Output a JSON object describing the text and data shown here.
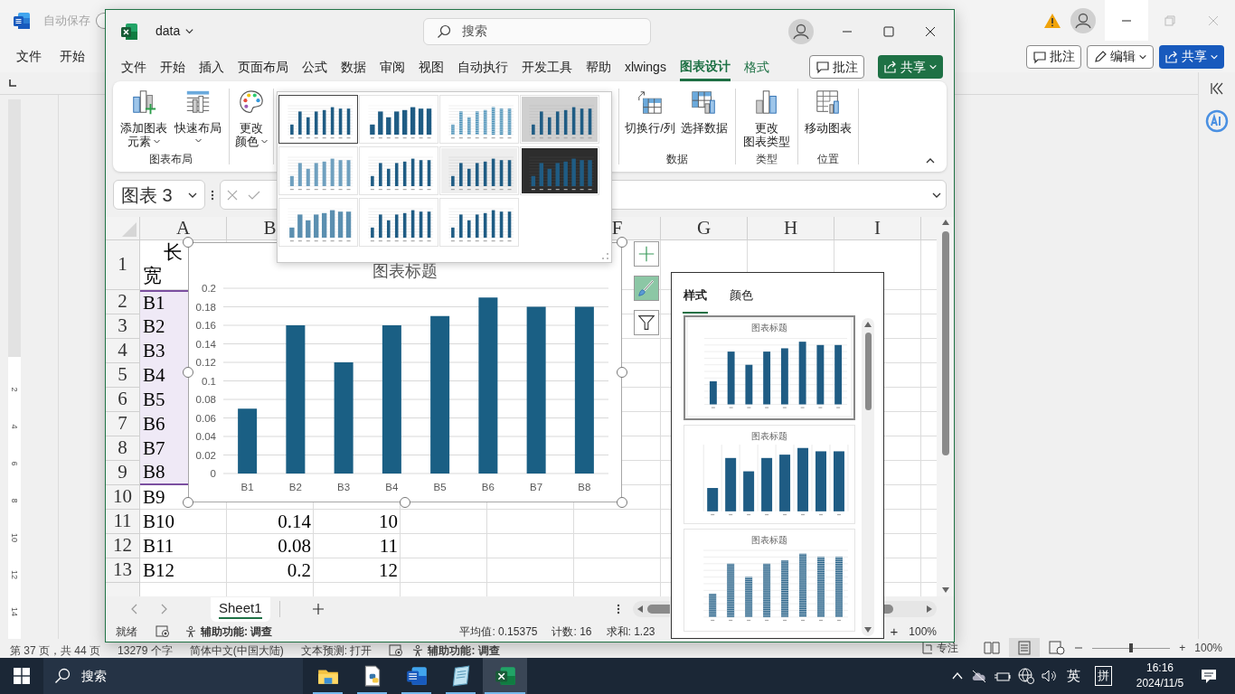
{
  "word_window": {
    "autosave_label": "自动保存",
    "autosave_on": false,
    "menu_tabs": [
      "文件",
      "开始"
    ],
    "buttons": [
      {
        "kind": "comment",
        "label": "批注"
      },
      {
        "kind": "edit",
        "label": "编辑"
      },
      {
        "kind": "share",
        "label": "共享"
      }
    ],
    "ruler_labels": [
      "2",
      "4",
      "6",
      "8",
      "10",
      "12",
      "14"
    ],
    "status_bar": {
      "items": [
        "第 37 页，共 44 页",
        "13279 个字",
        "简体中文(中国大陆)",
        "文本预测: 打开"
      ],
      "accessibility": "辅助功能: 调查",
      "focus": "专注",
      "zoom_slider": {
        "level": 0.5
      },
      "zoom_plus": "+",
      "zoom": "100%"
    }
  },
  "excel_window": {
    "title": "data",
    "search_placeholder": "搜索",
    "tabs": [
      {
        "label": "文件",
        "selected": false,
        "contextual": false
      },
      {
        "label": "开始",
        "selected": false,
        "contextual": false
      },
      {
        "label": "插入",
        "selected": false,
        "contextual": false
      },
      {
        "label": "页面布局",
        "selected": false,
        "contextual": false
      },
      {
        "label": "公式",
        "selected": false,
        "contextual": false
      },
      {
        "label": "数据",
        "selected": false,
        "contextual": false
      },
      {
        "label": "审阅",
        "selected": false,
        "contextual": false
      },
      {
        "label": "视图",
        "selected": false,
        "contextual": false
      },
      {
        "label": "自动执行",
        "selected": false,
        "contextual": false
      },
      {
        "label": "开发工具",
        "selected": false,
        "contextual": false
      },
      {
        "label": "帮助",
        "selected": false,
        "contextual": false
      },
      {
        "label": "xlwings",
        "selected": false,
        "contextual": false
      },
      {
        "label": "图表设计",
        "selected": true,
        "contextual": true
      },
      {
        "label": "格式",
        "selected": false,
        "contextual": true
      }
    ],
    "comment_button": "批注",
    "share_button": "共享",
    "ribbon": {
      "groups": [
        {
          "label": "图表布局",
          "buttons": [
            {
              "kind": "add-element",
              "lines": [
                "添加图表",
                "元素"
              ],
              "dropdown": true
            },
            {
              "kind": "quick-layout",
              "lines": [
                "快速布局"
              ],
              "dropdown": true
            }
          ]
        },
        {
          "buttons": [
            {
              "kind": "colors",
              "lines": [
                "更改",
                "颜色"
              ],
              "dropdown": true
            }
          ]
        },
        {
          "label": "数据",
          "buttons": [
            {
              "kind": "switch",
              "lines": [
                "切换行/列"
              ],
              "dropdown": false
            },
            {
              "kind": "select-data",
              "lines": [
                "选择数据"
              ],
              "dropdown": false
            }
          ]
        },
        {
          "label": "类型",
          "buttons": [
            {
              "kind": "change-type",
              "lines": [
                "更改",
                "图表类型"
              ],
              "dropdown": false
            }
          ]
        },
        {
          "label": "位置",
          "buttons": [
            {
              "kind": "move",
              "lines": [
                "移动图表"
              ],
              "dropdown": false
            }
          ]
        }
      ]
    },
    "style_gallery": {
      "styles": [
        {
          "kind": "plain",
          "selected": true
        },
        {
          "kind": "wide",
          "selected": false
        },
        {
          "kind": "dashed",
          "selected": false
        },
        {
          "kind": "gradient",
          "selected": false
        },
        {
          "kind": "outlined",
          "selected": false
        },
        {
          "kind": "plain",
          "selected": false
        },
        {
          "kind": "hatched",
          "selected": false
        },
        {
          "kind": "dark",
          "selected": false
        },
        {
          "kind": "pale",
          "selected": false
        },
        {
          "kind": "plain",
          "selected": false
        },
        {
          "kind": "plain",
          "selected": false
        }
      ]
    },
    "name_box": "图表 3",
    "columns": [
      "A",
      "B",
      null,
      null,
      null,
      "F",
      "G",
      "H",
      "I"
    ],
    "rows": [
      {
        "header": "1",
        "a_top": "长",
        "a_bottom": "宽",
        "highlighted": false
      },
      {
        "header": "2",
        "a": "B1",
        "highlighted": true
      },
      {
        "header": "3",
        "a": "B2",
        "highlighted": true
      },
      {
        "header": "4",
        "a": "B3",
        "highlighted": true
      },
      {
        "header": "5",
        "a": "B4",
        "highlighted": true
      },
      {
        "header": "6",
        "a": "B5",
        "highlighted": true
      },
      {
        "header": "7",
        "a": "B6",
        "highlighted": true
      },
      {
        "header": "8",
        "a": "B7",
        "highlighted": true
      },
      {
        "header": "9",
        "a": "B8",
        "highlighted": true
      },
      {
        "header": "10",
        "a": "B9",
        "highlighted": false
      },
      {
        "header": "11",
        "a": "B10",
        "b": "0.14",
        "c": "10",
        "highlighted": false
      },
      {
        "header": "12",
        "a": "B11",
        "b": "0.08",
        "c": "11",
        "highlighted": false
      },
      {
        "header": "13",
        "a": "B12",
        "b": "0.2",
        "c": "12",
        "highlighted": false
      }
    ],
    "chart": {
      "chart_data": {
        "type": "bar",
        "title": "图表标题",
        "categories": [
          "B1",
          "B2",
          "B3",
          "B4",
          "B5",
          "B6",
          "B7",
          "B8"
        ],
        "values": [
          0.07,
          0.16,
          0.12,
          0.16,
          0.17,
          0.19,
          0.18,
          0.18
        ],
        "grid": true,
        "ylim": [
          0,
          0.2
        ],
        "yticks": [
          0,
          0.02,
          0.04,
          0.06,
          0.08,
          0.1,
          0.12,
          0.14,
          0.16,
          0.18,
          0.2
        ]
      }
    },
    "chart_buttons": [
      {
        "kind": "add",
        "selected": false
      },
      {
        "kind": "style",
        "selected": true
      },
      {
        "kind": "filter",
        "selected": false
      }
    ],
    "style_pane": {
      "tabs": [
        {
          "label": "样式",
          "selected": true
        },
        {
          "label": "颜色",
          "selected": false
        }
      ],
      "styles": [
        {
          "kind": "plain",
          "title": "图表标题",
          "selected": true
        },
        {
          "kind": "labeled",
          "title": "图表标题",
          "selected": false
        },
        {
          "kind": "striped",
          "title": "图表标题",
          "selected": false
        }
      ]
    },
    "sheet_tabs": [
      {
        "label": "Sheet1",
        "selected": true
      }
    ],
    "status_bar": {
      "ready": "就绪",
      "accessibility": "辅助功能: 调查",
      "stats": [
        "平均值: 0.15375",
        "计数: 16",
        "求和: 1.23"
      ],
      "zoom_plus": "+",
      "zoom": "100%"
    }
  },
  "taskbar": {
    "search_placeholder": "搜索",
    "apps": [
      {
        "kind": "folder",
        "selected": false
      },
      {
        "kind": "python",
        "selected": false
      },
      {
        "kind": "word",
        "selected": false
      },
      {
        "kind": "notepad",
        "selected": false
      },
      {
        "kind": "excel",
        "selected": true
      }
    ],
    "ime_language": "英",
    "ime_mode": "拼",
    "time": "16:16",
    "date": "2024/11/5"
  }
}
